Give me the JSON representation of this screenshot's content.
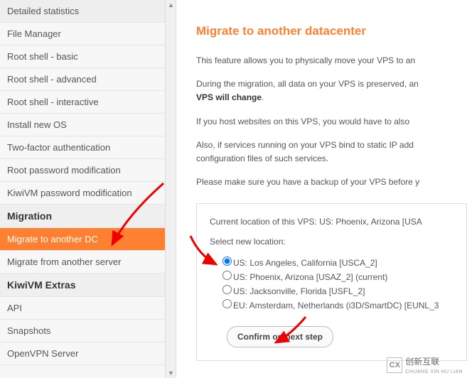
{
  "sidebar": {
    "items": [
      {
        "label": "Detailed statistics",
        "type": "item"
      },
      {
        "label": "File Manager",
        "type": "item"
      },
      {
        "label": "Root shell - basic",
        "type": "item"
      },
      {
        "label": "Root shell - advanced",
        "type": "item"
      },
      {
        "label": "Root shell - interactive",
        "type": "item"
      },
      {
        "label": "Install new OS",
        "type": "item"
      },
      {
        "label": "Two-factor authentication",
        "type": "item"
      },
      {
        "label": "Root password modification",
        "type": "item"
      },
      {
        "label": "KiwiVM password modification",
        "type": "item"
      },
      {
        "label": "Migration",
        "type": "section"
      },
      {
        "label": "Migrate to another DC",
        "type": "item",
        "selected": true
      },
      {
        "label": "Migrate from another server",
        "type": "item"
      },
      {
        "label": "KiwiVM Extras",
        "type": "section"
      },
      {
        "label": "API",
        "type": "item"
      },
      {
        "label": "Snapshots",
        "type": "item"
      },
      {
        "label": "OpenVPN Server",
        "type": "item"
      }
    ]
  },
  "main": {
    "title": "Migrate to another datacenter",
    "para1": "This feature allows you to physically move your VPS to an",
    "para2a": "During the migration, all data on your VPS is preserved, an",
    "para2b": "VPS will change",
    "para2bSuffix": ".",
    "para3": "If you host websites on this VPS, you would have to also ",
    "para4": "Also, if services running on your VPS bind to static IP add",
    "para5": "configuration files of such services.",
    "para6": "Please make sure you have a backup of your VPS before y",
    "panel": {
      "currentLocationLabel": "Current location of this VPS: US: Phoenix, Arizona [USA",
      "selectLabel": "Select new location:",
      "options": [
        {
          "label": "US: Los Angeles, California [USCA_2]",
          "selected": true
        },
        {
          "label": "US: Phoenix, Arizona [USAZ_2] (current)",
          "selected": false
        },
        {
          "label": "US: Jacksonville, Florida [USFL_2]",
          "selected": false
        },
        {
          "label": "EU: Amsterdam, Netherlands (i3D/SmartDC) [EUNL_3",
          "selected": false
        }
      ],
      "confirmLabel": "Confirm on next step"
    }
  },
  "watermark": {
    "brand": "创新互联",
    "sub": "CHUANG XIN HU LIAN"
  }
}
